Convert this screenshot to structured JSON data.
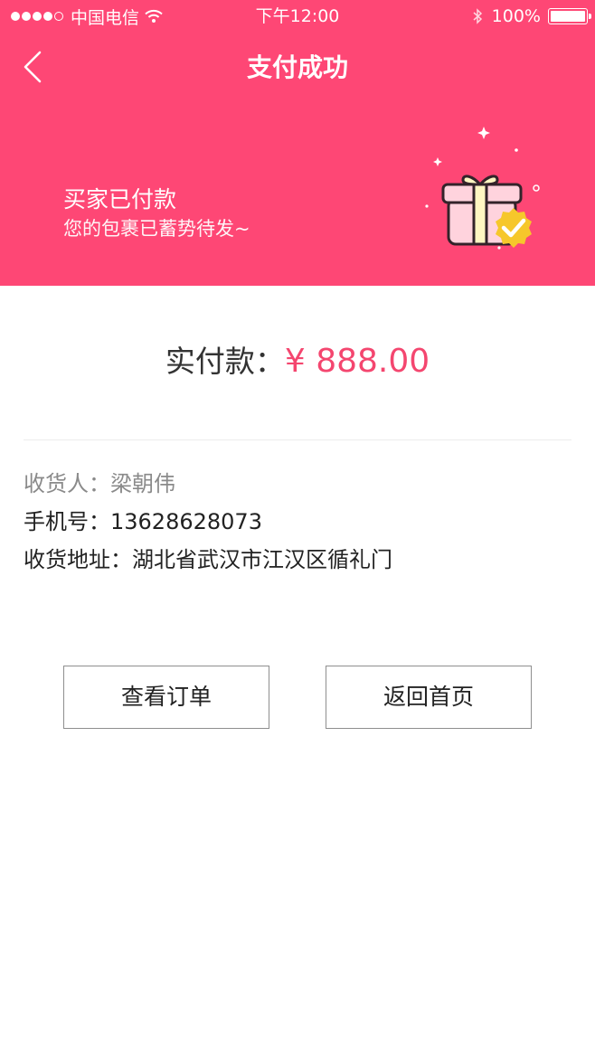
{
  "status_bar": {
    "carrier": "中国电信",
    "time": "下午12:00",
    "battery": "100%"
  },
  "nav": {
    "title": "支付成功"
  },
  "banner": {
    "title": "买家已付款",
    "subtitle": "您的包裹已蓄势待发~"
  },
  "payment": {
    "label": "实付款：",
    "amount": "¥ 888.00"
  },
  "shipping": {
    "recipient_label": "收货人：",
    "recipient_value": "梁朝伟",
    "phone_label": "手机号：",
    "phone_value": "13628628073",
    "address_label": "收货地址：",
    "address_value": "湖北省武汉市江汉区循礼门"
  },
  "actions": {
    "view_order": "查看订单",
    "back_home": "返回首页"
  },
  "colors": {
    "header_bg": "#fe4775",
    "price": "#f4466f"
  }
}
